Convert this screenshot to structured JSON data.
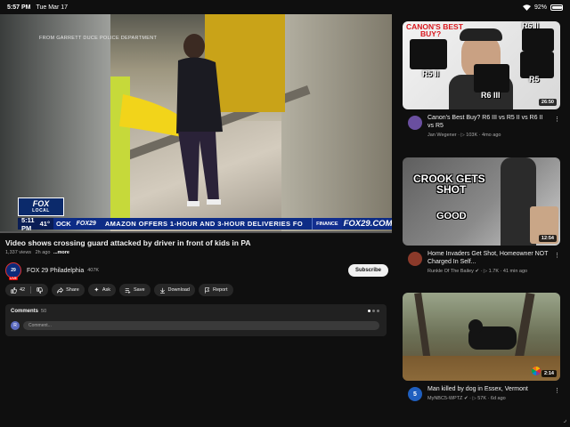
{
  "status": {
    "time": "5:57 PM",
    "date": "Tue Mar 17",
    "battery": "92%",
    "battery_level": 0.92
  },
  "player": {
    "watermark": "FROM GARRETT DUCE POLICE DEPARTMENT",
    "logo_brand": "FOX",
    "logo_sub": "LOCAL",
    "ticker": {
      "time": "5:11 PM",
      "temp": "41°",
      "network": "FOX29",
      "partial": "OCK",
      "headline": "AMAZON OFFERS 1-HOUR AND 3-HOUR DELIVERIES FO",
      "section": "FINANCE",
      "site": "FOX29.COM"
    },
    "progress": 0.0
  },
  "video": {
    "title": "Video shows crossing guard attacked by driver in front of kids in PA",
    "views": "1,337 views",
    "age": "2h ago",
    "more": "...more"
  },
  "channel": {
    "avatar_text": "29",
    "live": "LIVE",
    "name": "FOX 29 Philadelphia",
    "subs": "407K",
    "subscribe": "Subscribe"
  },
  "actions": {
    "likes": "42",
    "share": "Share",
    "ask": "Ask",
    "save": "Save",
    "download": "Download",
    "report": "Report"
  },
  "comments": {
    "label": "Comments",
    "count": "50",
    "avatar": "R",
    "placeholder": "Comment..."
  },
  "recommendations": [
    {
      "thumb_top": "CANON'S BEST",
      "thumb_top2": "BUY?",
      "labels": [
        "R5 II",
        "R6 II",
        "R6 III",
        "R5"
      ],
      "duration": "26:50",
      "title": "Canon's Best Buy? R6 III vs R5 II vs R6 II vs R5",
      "channel": "Jan Wegener",
      "views": "103K",
      "age": "4mo ago",
      "avatar_color": "#6a4fa0"
    },
    {
      "thumb_top": "CROOK GETS",
      "thumb_top2": "SHOT",
      "thumb_good": "GOOD",
      "duration": "12:54",
      "title": "Home Invaders Get Shot, Homeowner NOT Charged In Self...",
      "channel": "Runkle Of The Bailey",
      "views": "1.7K",
      "age": "41 min ago",
      "avatar_color": "#8b3a2a"
    },
    {
      "duration": "2:14",
      "title": "Man killed by dog in Essex, Vermont",
      "channel": "MyNBC5-WPTZ",
      "views": "57K",
      "age": "6d ago",
      "avatar_text": "5",
      "avatar_color": "#1f5fbf"
    }
  ]
}
